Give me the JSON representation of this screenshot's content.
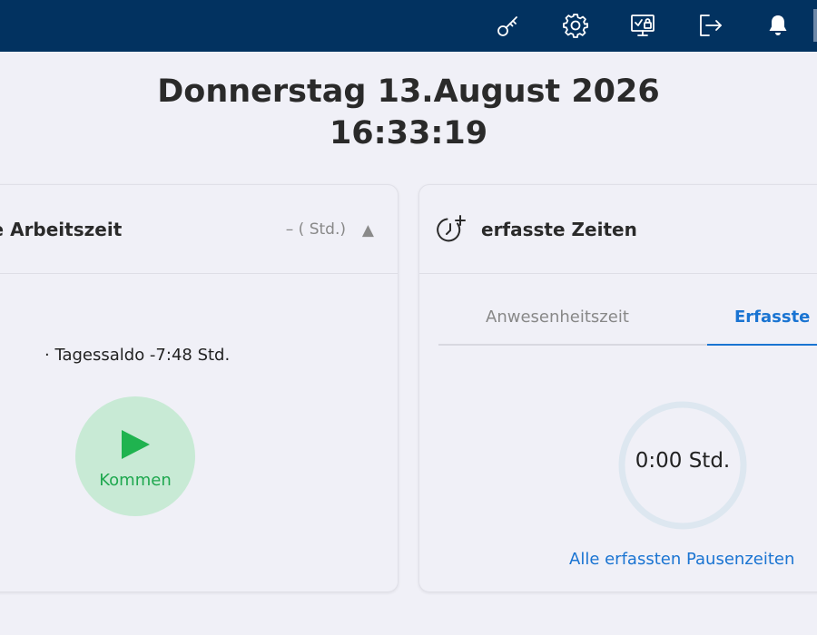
{
  "header": {
    "icons": [
      "key-icon",
      "gear-icon",
      "monitor-lock-icon",
      "logout-icon",
      "bell-icon"
    ]
  },
  "datetime": {
    "date": "Donnerstag 13.August 2026",
    "time": "16:33:19"
  },
  "work_card": {
    "title": "te Arbeitszeit",
    "hint": "– ( Std.)",
    "caret": "▲",
    "saldo": "· Tagessaldo -7:48 Std.",
    "come_button": "Kommen"
  },
  "times_card": {
    "title": "erfasste Zeiten",
    "tabs": [
      {
        "label": "Anwesenheitszeit",
        "active": false
      },
      {
        "label": "Erfasste P",
        "active": true
      }
    ],
    "ring_value": "0:00 Std.",
    "link": "Alle erfassten Pausenzeiten"
  },
  "colors": {
    "topbar": "#023260",
    "accent": "#1a74d2",
    "success": "#1fa84f",
    "success_bg": "#c8ead5"
  }
}
